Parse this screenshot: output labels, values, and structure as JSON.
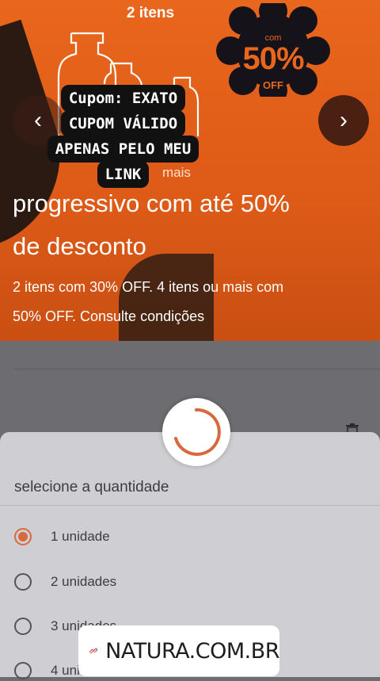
{
  "banner": {
    "top_label": "2 itens",
    "badge": {
      "prefix": "com",
      "percent": "50%",
      "suffix": "OFF"
    },
    "partial_text": "mais",
    "headline_line1": "progressivo com até 50%",
    "headline_line2": "de desconto",
    "subline_line1": "2 itens com 30% OFF. 4 itens ou mais com",
    "subline_line2": "50% OFF. Consulte condições",
    "prev_icon": "chevron-left-icon",
    "next_icon": "chevron-right-icon",
    "colors": {
      "accent": "#e9661d",
      "dark": "#2a1a12"
    }
  },
  "sticker": {
    "lines": [
      "Cupom: EXATO",
      "CUPOM VÁLIDO",
      "APENAS PELO MEU",
      "LINK"
    ]
  },
  "sheet": {
    "title": "selecione a quantidade",
    "options": [
      {
        "label": "1 unidade",
        "selected": true
      },
      {
        "label": "2 unidades",
        "selected": false
      },
      {
        "label": "3 unidades",
        "selected": false
      },
      {
        "label": "4 unidades",
        "selected": false
      }
    ],
    "accent": "#d8693f"
  },
  "link_sticker": {
    "text": "NATURA.COM.BR",
    "icon": "link-icon"
  },
  "loading": {
    "icon": "spinner-icon"
  }
}
